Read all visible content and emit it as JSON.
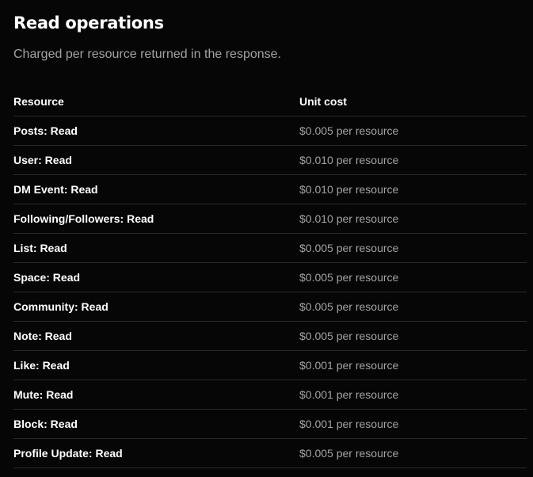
{
  "section": {
    "title": "Read operations",
    "subtitle": "Charged per resource returned in the response."
  },
  "table": {
    "headers": [
      "Resource",
      "Unit cost"
    ],
    "rows": [
      {
        "resource": "Posts: Read",
        "cost": "$0.005 per resource"
      },
      {
        "resource": "User: Read",
        "cost": "$0.010 per resource"
      },
      {
        "resource": "DM Event: Read",
        "cost": "$0.010 per resource"
      },
      {
        "resource": "Following/Followers: Read",
        "cost": "$0.010 per resource"
      },
      {
        "resource": "List: Read",
        "cost": "$0.005 per resource"
      },
      {
        "resource": "Space: Read",
        "cost": "$0.005 per resource"
      },
      {
        "resource": "Community: Read",
        "cost": "$0.005 per resource"
      },
      {
        "resource": "Note: Read",
        "cost": "$0.005 per resource"
      },
      {
        "resource": "Like: Read",
        "cost": "$0.001 per resource"
      },
      {
        "resource": "Mute: Read",
        "cost": "$0.001 per resource"
      },
      {
        "resource": "Block: Read",
        "cost": "$0.001 per resource"
      },
      {
        "resource": "Profile Update: Read",
        "cost": "$0.005 per resource"
      }
    ]
  },
  "colors": {
    "background": "#060606",
    "text_primary": "#ffffff",
    "text_secondary": "#a3a3a3",
    "divider": "#2a2a2a"
  }
}
